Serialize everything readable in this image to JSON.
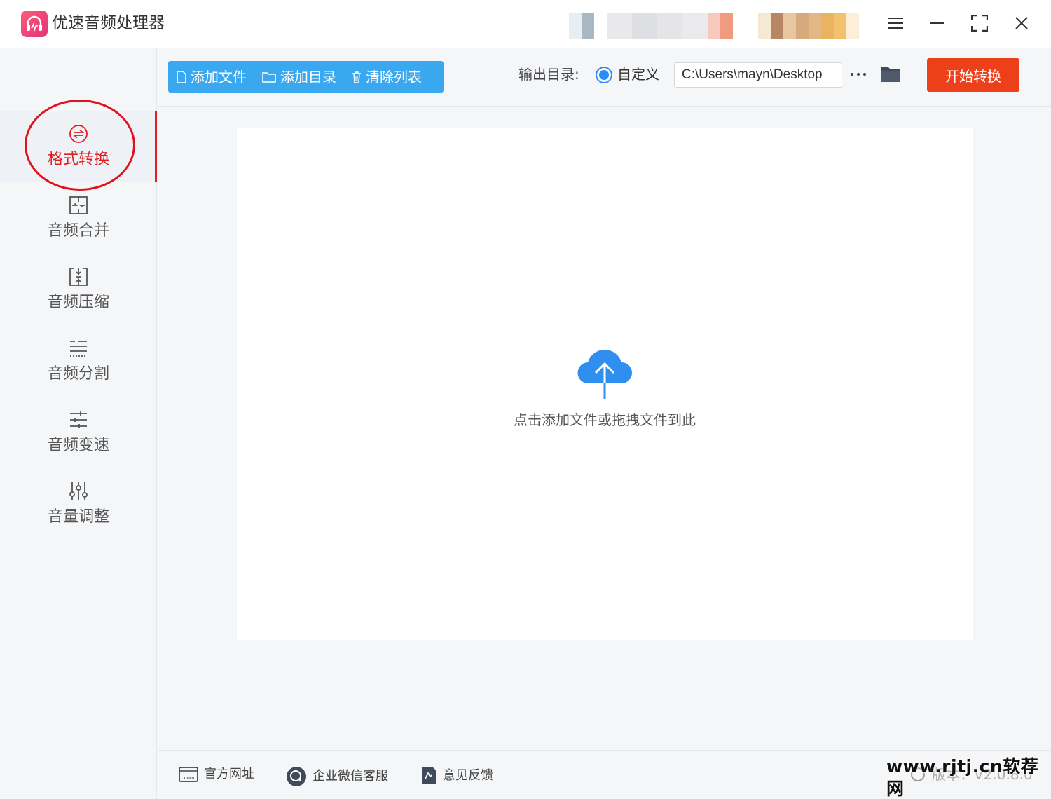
{
  "app": {
    "title": "优速音频处理器",
    "brand_color": "#e63d7a",
    "accent_color": "#3aa8ef"
  },
  "window_controls": [
    "menu-icon",
    "minimize-icon",
    "maximize-icon",
    "close-icon"
  ],
  "sidebar": {
    "active_index": 0,
    "active_color": "#e02020",
    "items": [
      {
        "label": "格式转换",
        "icon": "format-convert-icon"
      },
      {
        "label": "音频合并",
        "icon": "merge-icon"
      },
      {
        "label": "音频压缩",
        "icon": "compress-icon"
      },
      {
        "label": "音频分割",
        "icon": "split-icon"
      },
      {
        "label": "音频变速",
        "icon": "speed-icon"
      },
      {
        "label": "音量调整",
        "icon": "volume-adjust-icon"
      }
    ]
  },
  "toolbar": {
    "add_file": "添加文件",
    "add_dir": "添加目录",
    "clear_list": "清除列表",
    "output_label": "输出目录:",
    "output_mode": "自定义",
    "output_path": "C:\\Users\\mayn\\Desktop",
    "more": "···",
    "start": "开始转换",
    "start_color": "#ee3f1b"
  },
  "dropzone": {
    "hint": "点击添加文件或拖拽文件到此",
    "icon": "cloud-upload-icon",
    "icon_color": "#2f8ff0"
  },
  "footer": {
    "website": "官方网址",
    "wechat_service": "企业微信客服",
    "feedback": "意见反馈",
    "version": "版本：V2.0.8.0"
  },
  "watermark": "www.rjtj.cn软荐网"
}
